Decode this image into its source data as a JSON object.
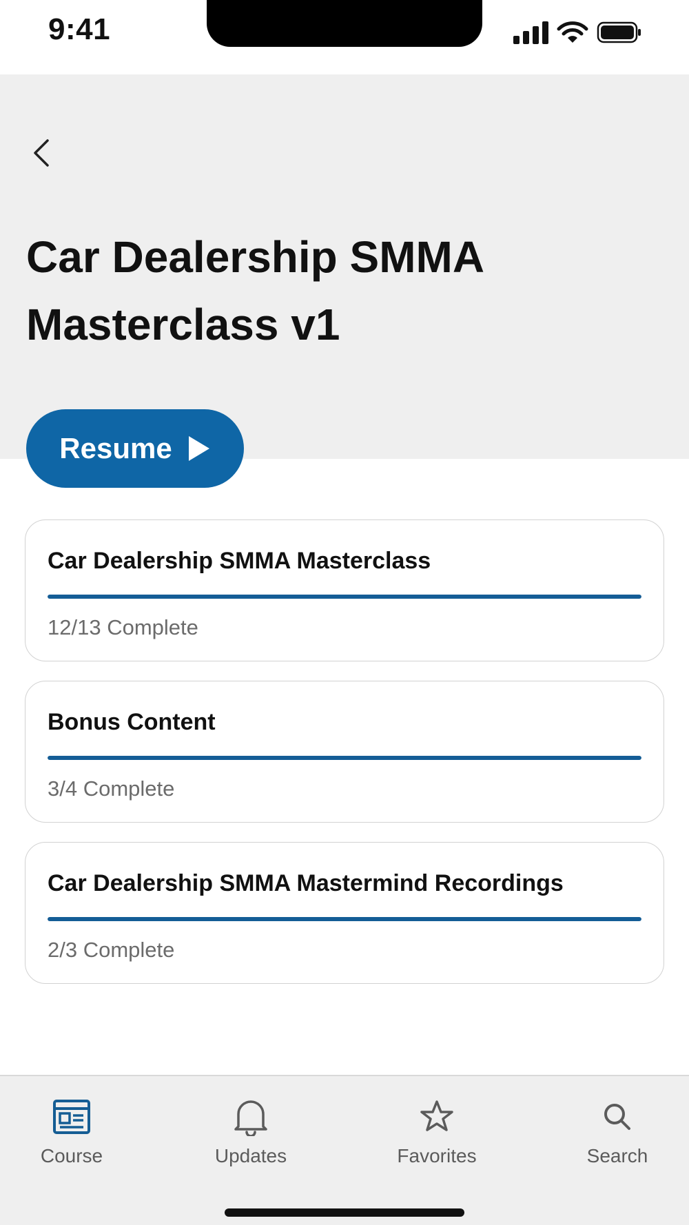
{
  "status_bar": {
    "time": "9:41"
  },
  "header": {
    "title": "Car Dealership SMMA Masterclass v1"
  },
  "resume_button": {
    "label": "Resume"
  },
  "modules": [
    {
      "title": "Car Dealership SMMA Masterclass",
      "status": "12/13 Complete",
      "progress": 1.0
    },
    {
      "title": "Bonus Content",
      "status": "3/4 Complete",
      "progress": 1.0
    },
    {
      "title": "Car Dealership SMMA Mastermind Recordings",
      "status": "2/3 Complete",
      "progress": 1.0
    }
  ],
  "tab_bar": {
    "tabs": [
      {
        "label": "Course",
        "icon": "course-icon",
        "active": true
      },
      {
        "label": "Updates",
        "icon": "bell-icon",
        "active": false
      },
      {
        "label": "Favorites",
        "icon": "star-icon",
        "active": false
      },
      {
        "label": "Search",
        "icon": "search-icon",
        "active": false
      }
    ]
  },
  "colors": {
    "accent": "#0f66a6",
    "progress": "#145d96",
    "header_bg": "#efefef",
    "tab_active": "#155d94",
    "tab_inactive": "#5b5b5b"
  }
}
